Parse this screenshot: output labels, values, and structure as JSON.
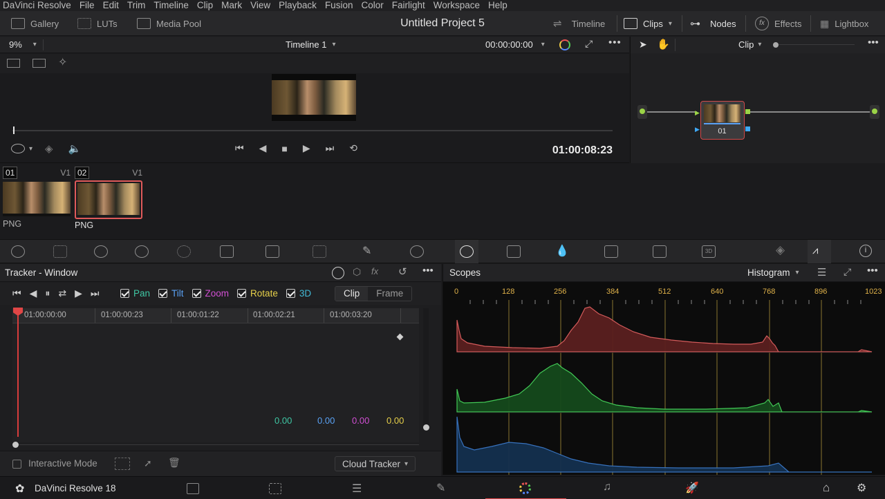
{
  "menu": [
    "DaVinci Resolve",
    "File",
    "Edit",
    "Trim",
    "Timeline",
    "Clip",
    "Mark",
    "View",
    "Playback",
    "Fusion",
    "Color",
    "Fairlight",
    "Workspace",
    "Help"
  ],
  "toolbar": {
    "gallery": "Gallery",
    "luts": "LUTs",
    "media_pool": "Media Pool",
    "project_title": "Untitled Project 5",
    "timeline": "Timeline",
    "clips": "Clips",
    "nodes": "Nodes",
    "effects": "Effects",
    "lightbox": "Lightbox"
  },
  "viewer": {
    "zoom": "9%",
    "timeline_name": "Timeline 1",
    "source_timecode": "00:00:00:00",
    "timecode": "01:00:08:23"
  },
  "node_editor": {
    "mode": "Clip",
    "node_label": "01"
  },
  "clips": [
    {
      "num": "01",
      "track": "V1",
      "format": "PNG"
    },
    {
      "num": "02",
      "track": "V1",
      "format": "PNG"
    }
  ],
  "tracker": {
    "title": "Tracker - Window",
    "options": [
      {
        "label": "Pan",
        "color": "#3fc7a4"
      },
      {
        "label": "Tilt",
        "color": "#5aa2f5"
      },
      {
        "label": "Zoom",
        "color": "#d14fd3"
      },
      {
        "label": "Rotate",
        "color": "#e7d04a"
      },
      {
        "label": "3D",
        "color": "#42b9d6"
      }
    ],
    "mode_clip": "Clip",
    "mode_frame": "Frame",
    "ruler": [
      "01:00:00:00",
      "01:00:00:23",
      "01:00:01:22",
      "01:00:02:21",
      "01:00:03:20"
    ],
    "values": [
      {
        "v": "0.00",
        "color": "#3fc7a4"
      },
      {
        "v": "0.00",
        "color": "#5aa2f5"
      },
      {
        "v": "0.00",
        "color": "#d14fd3"
      },
      {
        "v": "0.00",
        "color": "#e7d04a"
      }
    ],
    "interactive_mode": "Interactive Mode",
    "cloud_tracker": "Cloud Tracker"
  },
  "scopes": {
    "title": "Scopes",
    "type": "Histogram",
    "ticks": [
      "0",
      "128",
      "256",
      "384",
      "512",
      "640",
      "768",
      "896",
      "1023"
    ]
  },
  "bottom": {
    "app_name": "DaVinci Resolve 18"
  }
}
